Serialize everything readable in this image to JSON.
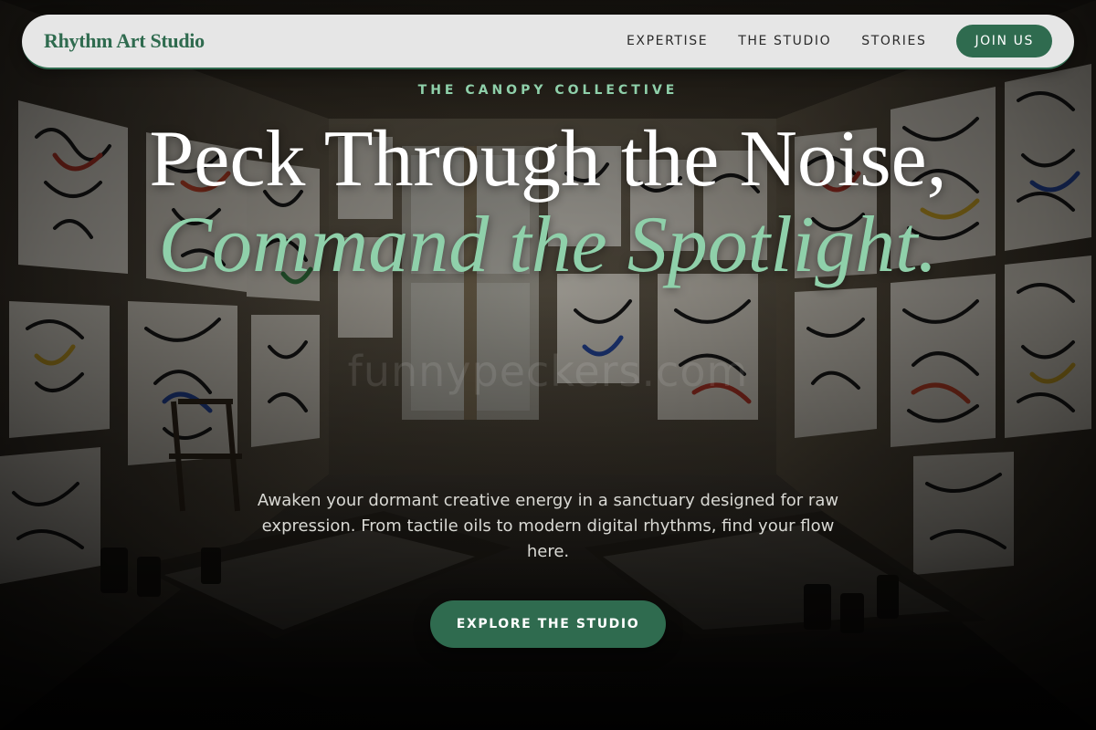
{
  "nav": {
    "brand": "Rhythm Art Studio",
    "links": [
      "EXPERTISE",
      "THE STUDIO",
      "STORIES"
    ],
    "join_label": "JOIN US"
  },
  "hero": {
    "eyebrow": "THE CANOPY COLLECTIVE",
    "headline_line1": "Peck Through the Noise,",
    "headline_accent": "Command the Spotlight.",
    "description": "Awaken your dormant creative energy in a sanctuary designed for raw expression. From tactile oils to modern digital rhythms, find your flow here.",
    "cta_label": "EXPLORE THE STUDIO"
  },
  "watermark": "funnypeckers.com",
  "colors": {
    "brand_green": "#2f6b4f",
    "accent_mint": "#8fd0aa",
    "nav_bg": "#e6e6e6",
    "headline_white": "#ffffff",
    "body_text": "#d9d9d4"
  }
}
